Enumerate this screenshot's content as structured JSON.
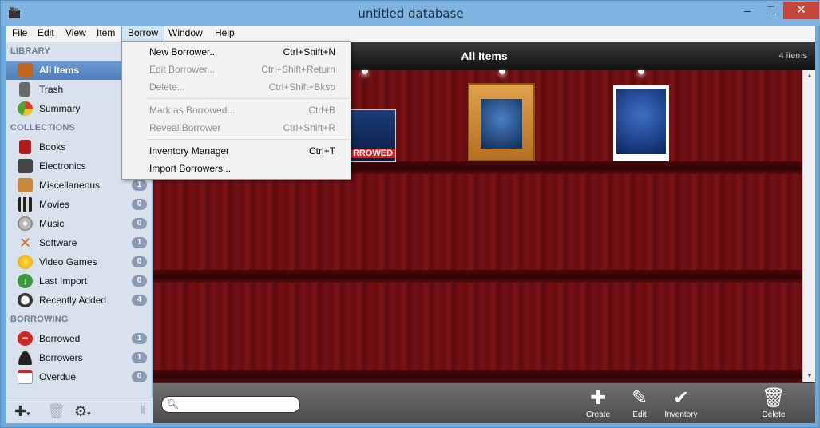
{
  "window": {
    "title": "untitled database"
  },
  "menubar": [
    {
      "label": "File"
    },
    {
      "label": "Edit"
    },
    {
      "label": "View"
    },
    {
      "label": "Item"
    },
    {
      "label": "Borrow"
    },
    {
      "label": "Window"
    },
    {
      "label": "Help"
    }
  ],
  "sidebar": {
    "library_header": "LIBRARY",
    "library": [
      {
        "label": "All Items",
        "badge": ""
      },
      {
        "label": "Trash",
        "badge": ""
      },
      {
        "label": "Summary",
        "badge": ""
      }
    ],
    "collections_header": "COLLECTIONS",
    "collections": [
      {
        "label": "Books",
        "badge": ""
      },
      {
        "label": "Electronics",
        "badge": ""
      },
      {
        "label": "Miscellaneous",
        "badge": "1"
      },
      {
        "label": "Movies",
        "badge": "0"
      },
      {
        "label": "Music",
        "badge": "0"
      },
      {
        "label": "Software",
        "badge": "1"
      },
      {
        "label": "Video Games",
        "badge": "0"
      },
      {
        "label": "Last Import",
        "badge": "0"
      },
      {
        "label": "Recently Added",
        "badge": "4"
      }
    ],
    "borrowing_header": "BORROWING",
    "borrowing": [
      {
        "label": "Borrowed",
        "badge": "1"
      },
      {
        "label": "Borrowers",
        "badge": "1"
      },
      {
        "label": "Overdue",
        "badge": "0"
      }
    ]
  },
  "main": {
    "title": "All Items",
    "count": "4 items",
    "borrowed_tag": "RROWED",
    "toolbar": {
      "create": "Create",
      "edit": "Edit",
      "inventory": "Inventory",
      "delete": "Delete"
    }
  },
  "borrow_menu": {
    "items": [
      {
        "label": "New Borrower...",
        "shortcut": "Ctrl+Shift+N",
        "enabled": true
      },
      {
        "label": "Edit Borrower...",
        "shortcut": "Ctrl+Shift+Return",
        "enabled": false
      },
      {
        "label": "Delete...",
        "shortcut": "Ctrl+Shift+Bksp",
        "enabled": false
      },
      {
        "label": "Mark as Borrowed...",
        "shortcut": "Ctrl+B",
        "enabled": false
      },
      {
        "label": "Reveal Borrower",
        "shortcut": "Ctrl+Shift+R",
        "enabled": false
      },
      {
        "label": "Inventory Manager",
        "shortcut": "Ctrl+T",
        "enabled": true
      },
      {
        "label": "Import Borrowers...",
        "shortcut": "",
        "enabled": true
      }
    ]
  },
  "colors": {
    "accent": "#4e7ebd",
    "shelf": "#6a0c10",
    "borrowed": "#d61c1c"
  }
}
